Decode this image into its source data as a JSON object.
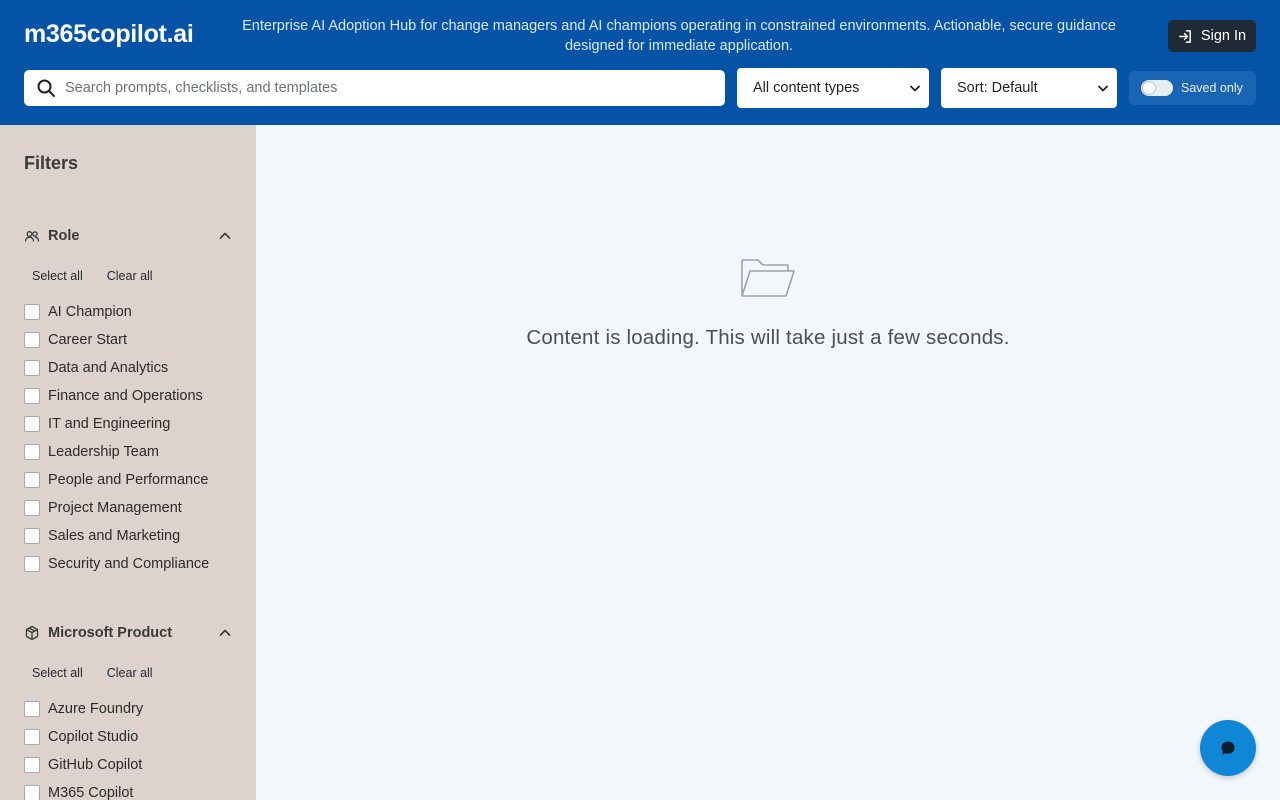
{
  "header": {
    "logo": "m365copilot.ai",
    "tagline": "Enterprise AI Adoption Hub for change managers and AI champions operating in constrained environments. Actionable, secure guidance designed for immediate application.",
    "sign_in_label": "Sign In"
  },
  "toolbar": {
    "search_placeholder": "Search prompts, checklists, and templates",
    "content_type_selected": "All content types",
    "sort_selected": "Sort: Default",
    "saved_only_label": "Saved only",
    "saved_only_enabled": false
  },
  "sidebar": {
    "title": "Filters",
    "sections": [
      {
        "title": "Role",
        "icon": "users-icon",
        "select_all_label": "Select all",
        "clear_all_label": "Clear all",
        "options": [
          "AI Champion",
          "Career Start",
          "Data and Analytics",
          "Finance and Operations",
          "IT and Engineering",
          "Leadership Team",
          "People and Performance",
          "Project Management",
          "Sales and Marketing",
          "Security and Compliance"
        ]
      },
      {
        "title": "Microsoft Product",
        "icon": "package-icon",
        "select_all_label": "Select all",
        "clear_all_label": "Clear all",
        "options": [
          "Azure Foundry",
          "Copilot Studio",
          "GitHub Copilot",
          "M365 Copilot"
        ]
      }
    ]
  },
  "main": {
    "empty_icon": "folder-icon",
    "loading_message": "Content is loading. This will take just a few seconds."
  },
  "colors": {
    "header_bg": "#0453a6",
    "sidebar_bg": "#ddd3cc",
    "page_bg": "#f3f7fb",
    "chat_button": "#0f86d6"
  }
}
